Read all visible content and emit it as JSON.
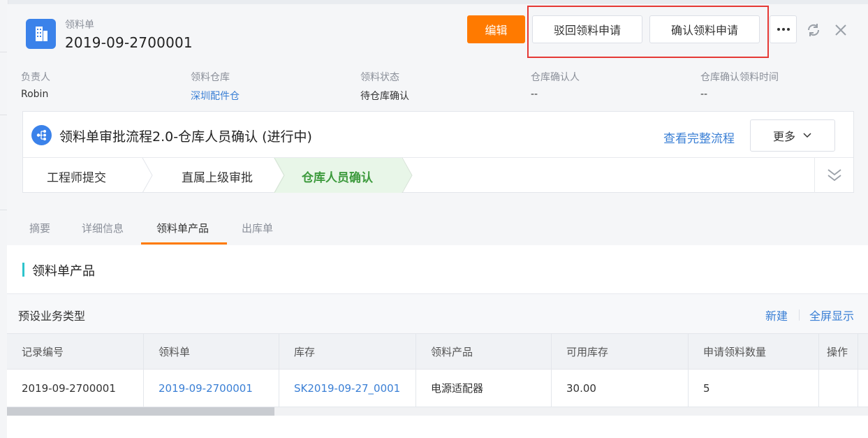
{
  "header": {
    "type_label": "领料单",
    "record_no": "2019-09-2700001",
    "icon": "building-icon",
    "buttons": {
      "edit": "编辑",
      "reject": "驳回领料申请",
      "confirm": "确认领料申请"
    },
    "more_icon": "ellipsis-icon",
    "refresh_icon": "refresh-icon",
    "close_icon": "close-icon",
    "highlight_color": "#e53935"
  },
  "fields": [
    {
      "label": "负责人",
      "value": "Robin"
    },
    {
      "label": "领料仓库",
      "value": "深圳配件仓"
    },
    {
      "label": "领料状态",
      "value": "待仓库确认"
    },
    {
      "label": "仓库确认人",
      "value": "--"
    },
    {
      "label": "仓库确认领料时间",
      "value": "--"
    }
  ],
  "process": {
    "title": "领料单审批流程2.0-仓库人员确认 (进行中)",
    "view_full_link": "查看完整流程",
    "more_button": "更多",
    "steps": [
      {
        "label": "工程师提交",
        "active": false
      },
      {
        "label": "直属上级审批",
        "active": false
      },
      {
        "label": "仓库人员确认",
        "active": true
      }
    ]
  },
  "tabs": [
    {
      "label": "摘要",
      "active": false
    },
    {
      "label": "详细信息",
      "active": false
    },
    {
      "label": "领料单产品",
      "active": true
    },
    {
      "label": "出库单",
      "active": false
    }
  ],
  "section": {
    "title": "领料单产品",
    "subheader": "预设业务类型",
    "new_link": "新建",
    "fullscreen_link": "全屏显示"
  },
  "table": {
    "columns": [
      "记录编号",
      "领料单",
      "库存",
      "领料产品",
      "可用库存",
      "申请领料数量",
      "操作"
    ],
    "rows": [
      [
        "2019-09-2700001",
        "2019-09-2700001",
        "SK2019-09-27_0001",
        "电源适配器",
        "30.00",
        "5",
        ""
      ]
    ]
  },
  "colors": {
    "accent_orange": "#ff7a00",
    "link_blue": "#3a7fd5",
    "brand_blue": "#3b82ea",
    "active_step_green": "#3c9a3c",
    "section_bar_teal": "#2ec4cc"
  }
}
